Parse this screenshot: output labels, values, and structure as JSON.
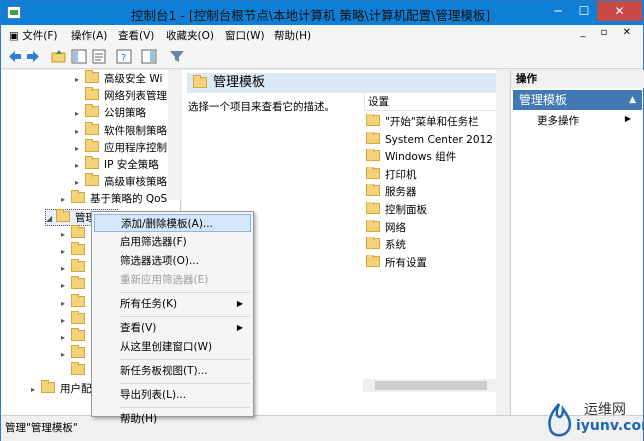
{
  "window": {
    "title": "控制台1 - [控制台根节点\\本地计算机 策略\\计算机配置\\管理模板]"
  },
  "menubar": [
    "文件(F)",
    "操作(A)",
    "查看(V)",
    "收藏夹(O)",
    "窗口(W)",
    "帮助(H)"
  ],
  "tree": [
    {
      "label": "高级安全 Wi",
      "indent": 1,
      "arrow": "▸"
    },
    {
      "label": "网络列表管理",
      "indent": 1,
      "arrow": ""
    },
    {
      "label": "公钥策略",
      "indent": 1,
      "arrow": "▸"
    },
    {
      "label": "软件限制策略",
      "indent": 1,
      "arrow": "▸"
    },
    {
      "label": "应用程序控制",
      "indent": 1,
      "arrow": "▸"
    },
    {
      "label": "IP 安全策略",
      "indent": 1,
      "arrow": "▸"
    },
    {
      "label": "高级审核策略",
      "indent": 1,
      "arrow": "▸"
    },
    {
      "label": "基于策略的 QoS",
      "indent": 0,
      "arrow": "▸"
    },
    {
      "label": "管理模板",
      "indent": -1,
      "arrow": "◢"
    },
    {
      "label": "",
      "indent": 0,
      "arrow": "▸"
    },
    {
      "label": "",
      "indent": 0,
      "arrow": "▸"
    },
    {
      "label": "",
      "indent": 0,
      "arrow": "▸"
    },
    {
      "label": "",
      "indent": 0,
      "arrow": "▸"
    },
    {
      "label": "",
      "indent": 0,
      "arrow": "▸"
    },
    {
      "label": "",
      "indent": 0,
      "arrow": "▸"
    },
    {
      "label": "",
      "indent": 0,
      "arrow": "▸"
    },
    {
      "label": "",
      "indent": 0,
      "arrow": "▸"
    },
    {
      "label": "",
      "indent": 0,
      "arrow": ""
    },
    {
      "label": "用户配",
      "indent": -2,
      "arrow": "▸"
    }
  ],
  "middle": {
    "header": "管理模板",
    "description": "选择一个项目来查看它的描述。",
    "column": "设置",
    "items": [
      "\"开始\"菜单和任务栏",
      "System Center 2012 - Op",
      "Windows 组件",
      "打印机",
      "服务器",
      "控制面板",
      "网络",
      "系统",
      "所有设置"
    ]
  },
  "actions": {
    "header": "操作",
    "section": "管理模板",
    "item": "更多操作"
  },
  "context_menu": [
    {
      "label": "添加/删除模板(A)...",
      "highlight": true
    },
    {
      "label": "启用筛选器(F)"
    },
    {
      "label": "筛选器选项(O)..."
    },
    {
      "label": "重新应用筛选器(E)",
      "disabled": true
    },
    {
      "sep": true
    },
    {
      "label": "所有任务(K)",
      "submenu": true
    },
    {
      "sep": true
    },
    {
      "label": "查看(V)",
      "submenu": true
    },
    {
      "label": "从这里创建窗口(W)"
    },
    {
      "sep": true
    },
    {
      "label": "新任务板视图(T)..."
    },
    {
      "sep": true
    },
    {
      "label": "导出列表(L)..."
    },
    {
      "sep": true
    },
    {
      "label": "帮助(H)"
    }
  ],
  "status": "管理\"管理模板\"",
  "watermark": {
    "name": "运维网",
    "url": "iyunv.com"
  }
}
